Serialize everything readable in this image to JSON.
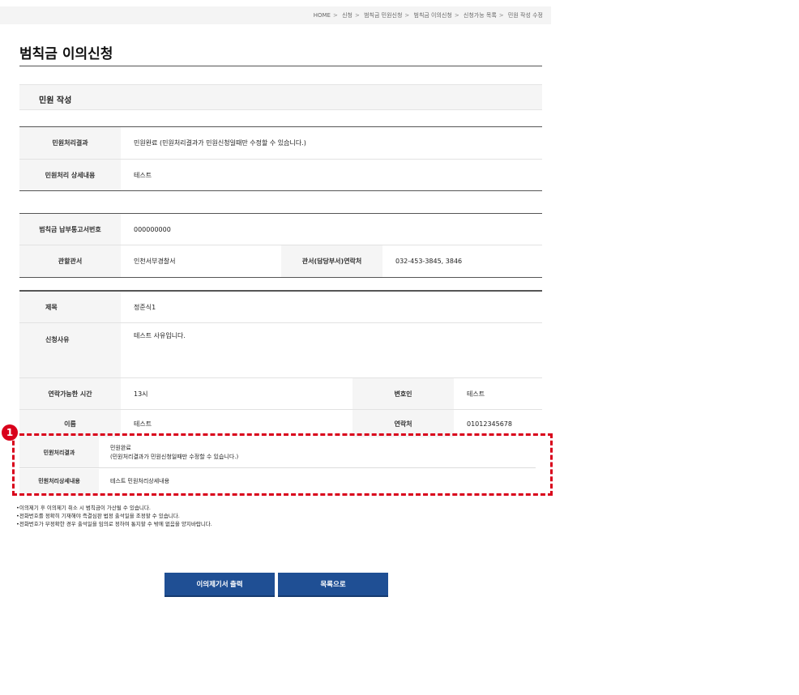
{
  "breadcrumb": [
    "HOME",
    "신청",
    "범칙금 민원신청",
    "범칙금 이의신청",
    "신청가능 목록",
    "민원 작성 수정"
  ],
  "breadcrumb_separator": ">",
  "page_title": "범칙금 이의신청",
  "section_title": "민원 작성",
  "result_table": {
    "result_label": "민원처리결과",
    "result_value": "민원완료 (민원처리결과가 민원신청일때만 수정할 수 있습니다.)",
    "detail_label": "민원처리 상세내용",
    "detail_value": "테스트"
  },
  "notice_table": {
    "notice_no_label": "범칙금 납부통고서번호",
    "notice_no_value": "000000000",
    "office_label": "관할관서",
    "office_value": "인천서부경찰서",
    "contact_label": "관서(담당부서)연락처",
    "contact_value": "032-453-3845, 3846"
  },
  "apply_table": {
    "subject_label": "제목",
    "subject_value": "정준식1",
    "reason_label": "신청사유",
    "reason_value": "테스트 사유입니다.",
    "time_label": "연락가능한 시간",
    "time_value": "13시",
    "lawyer_label": "변호인",
    "lawyer_value": "테스트",
    "name_label": "이름",
    "name_value": "테스트",
    "phone_label": "연락처",
    "phone_value": "01012345678"
  },
  "highlight": {
    "badge": "1",
    "result_label": "민원처리결과",
    "result_line1": "민원완료",
    "result_line2": "(민원처리결과가 민원신청일때만 수정할 수 있습니다.)",
    "detail_label": "민원처리상세내용",
    "detail_value": "테스트 민원처리상세내용",
    "accent_color": "#d9001b"
  },
  "notes": [
    "•이의제기 후 이의제기 취소 시 범칙금이 가산될 수 있습니다.",
    "•전화번호를 정확히 기재해야 즉결심판 법정 출석일을 조정할 수 있습니다.",
    "•전화번호가 부정확한 경우 출석일을 임의로 정하여 통지할 수 밖에 없음을 양지바랍니다."
  ],
  "buttons": {
    "print_label": "이의제기서 출력",
    "list_label": "목록으로",
    "color": "#1f4f94"
  }
}
